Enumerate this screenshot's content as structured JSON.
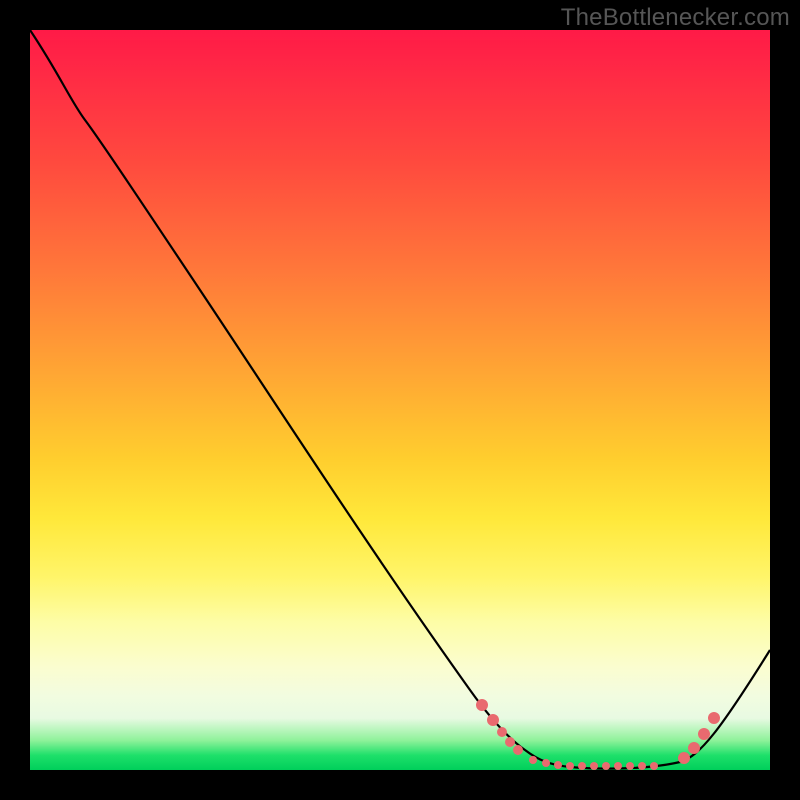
{
  "watermark": "TheBottlenecker.com",
  "chart_data": {
    "type": "line",
    "title": "",
    "xlabel": "",
    "ylabel": "",
    "x_range_norm": [
      0,
      1
    ],
    "y_range_norm": [
      0,
      1
    ],
    "note": "No axis ticks or numeric labels are rendered in the image; values below are normalized estimates (0 = bottom/left, 1 = top/right) read from pixel positions on a 740×740 plot area.",
    "series": [
      {
        "name": "bottleneck-curve",
        "x": [
          0.0,
          0.07,
          0.15,
          0.23,
          0.34,
          0.46,
          0.59,
          0.65,
          0.7,
          0.78,
          0.85,
          0.9,
          0.95,
          1.0
        ],
        "y": [
          1.0,
          0.88,
          0.76,
          0.65,
          0.49,
          0.3,
          0.11,
          0.05,
          0.02,
          0.004,
          0.006,
          0.02,
          0.08,
          0.16
        ]
      }
    ],
    "sample_points_norm": [
      {
        "x": 0.611,
        "y": 0.088
      },
      {
        "x": 0.626,
        "y": 0.068
      },
      {
        "x": 0.638,
        "y": 0.051
      },
      {
        "x": 0.649,
        "y": 0.038
      },
      {
        "x": 0.659,
        "y": 0.027
      },
      {
        "x": 0.68,
        "y": 0.014
      },
      {
        "x": 0.697,
        "y": 0.009
      },
      {
        "x": 0.714,
        "y": 0.007
      },
      {
        "x": 0.73,
        "y": 0.005
      },
      {
        "x": 0.746,
        "y": 0.005
      },
      {
        "x": 0.762,
        "y": 0.005
      },
      {
        "x": 0.778,
        "y": 0.005
      },
      {
        "x": 0.795,
        "y": 0.005
      },
      {
        "x": 0.811,
        "y": 0.005
      },
      {
        "x": 0.827,
        "y": 0.005
      },
      {
        "x": 0.843,
        "y": 0.005
      },
      {
        "x": 0.884,
        "y": 0.016
      },
      {
        "x": 0.897,
        "y": 0.03
      },
      {
        "x": 0.911,
        "y": 0.049
      },
      {
        "x": 0.924,
        "y": 0.07
      }
    ],
    "background_gradient_stops": [
      {
        "pos": 0.0,
        "color": "#ff1a47"
      },
      {
        "pos": 0.18,
        "color": "#ff4a3e"
      },
      {
        "pos": 0.46,
        "color": "#ffa534"
      },
      {
        "pos": 0.66,
        "color": "#ffe83a"
      },
      {
        "pos": 0.86,
        "color": "#fbfdcf"
      },
      {
        "pos": 0.96,
        "color": "#8ef29a"
      },
      {
        "pos": 1.0,
        "color": "#00cf5b"
      }
    ],
    "colors": {
      "curve": "#000000",
      "points": "#e96a6f",
      "frame": "#000000"
    }
  }
}
